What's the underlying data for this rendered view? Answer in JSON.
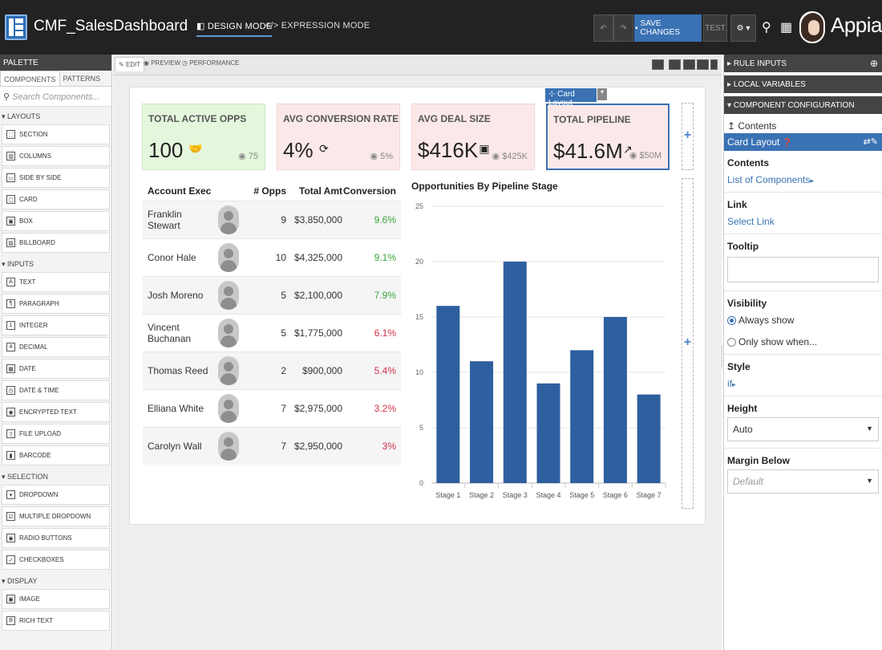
{
  "topbar": {
    "app_title": "CMF_SalesDashboard",
    "design_mode": "DESIGN MODE",
    "expression_mode": "EXPRESSION MODE",
    "save_changes": "SAVE CHANGES",
    "test": "TEST",
    "brand": "Appian",
    "icons": [
      "undo-icon",
      "redo-icon",
      "save-icon",
      "gear-icon",
      "search-people-icon",
      "apps-grid-icon"
    ]
  },
  "palette": {
    "header": "PALETTE",
    "tabs": [
      "COMPONENTS",
      "PATTERNS"
    ],
    "search_placeholder": "Search Components...",
    "sections": [
      {
        "title": "LAYOUTS",
        "items": [
          {
            "label": "SECTION",
            "icon": "section-icon",
            "glyph": "⬚"
          },
          {
            "label": "COLUMNS",
            "icon": "columns-icon",
            "glyph": "▥"
          },
          {
            "label": "SIDE BY SIDE",
            "icon": "side-by-side-icon",
            "glyph": "▭"
          },
          {
            "label": "CARD",
            "icon": "card-icon",
            "glyph": "▢"
          },
          {
            "label": "BOX",
            "icon": "box-icon",
            "glyph": "▣"
          },
          {
            "label": "BILLBOARD",
            "icon": "billboard-icon",
            "glyph": "▨"
          }
        ]
      },
      {
        "title": "INPUTS",
        "items": [
          {
            "label": "TEXT",
            "icon": "text-icon",
            "glyph": "A"
          },
          {
            "label": "PARAGRAPH",
            "icon": "paragraph-icon",
            "glyph": "¶"
          },
          {
            "label": "INTEGER",
            "icon": "integer-icon",
            "glyph": "1"
          },
          {
            "label": "DECIMAL",
            "icon": "decimal-icon",
            "glyph": "4"
          },
          {
            "label": "DATE",
            "icon": "date-icon",
            "glyph": "▦"
          },
          {
            "label": "DATE & TIME",
            "icon": "date-time-icon",
            "glyph": "◷"
          },
          {
            "label": "ENCRYPTED TEXT",
            "icon": "lock-icon",
            "glyph": "◉"
          },
          {
            "label": "FILE UPLOAD",
            "icon": "upload-icon",
            "glyph": "⇧"
          },
          {
            "label": "BARCODE",
            "icon": "barcode-icon",
            "glyph": "▮"
          }
        ]
      },
      {
        "title": "SELECTION",
        "items": [
          {
            "label": "DROPDOWN",
            "icon": "dropdown-icon",
            "glyph": "▾"
          },
          {
            "label": "MULTIPLE DROPDOWN",
            "icon": "multiple-dropdown-icon",
            "glyph": "☑"
          },
          {
            "label": "RADIO BUTTONS",
            "icon": "radio-icon",
            "glyph": "◉"
          },
          {
            "label": "CHECKBOXES",
            "icon": "checkbox-icon",
            "glyph": "✓"
          }
        ]
      },
      {
        "title": "DISPLAY",
        "items": [
          {
            "label": "IMAGE",
            "icon": "image-icon",
            "glyph": "▣"
          },
          {
            "label": "RICH TEXT",
            "icon": "rich-text-icon",
            "glyph": "B"
          }
        ]
      }
    ]
  },
  "editor": {
    "tabs": [
      "EDIT",
      "PREVIEW",
      "PERFORMANCE"
    ]
  },
  "kpis": [
    {
      "label": "TOTAL ACTIVE OPPS",
      "value": "100",
      "sub": "75",
      "icon": "handshake-icon",
      "glyph": "🤝",
      "bg": "#e4f7dc",
      "border": "#cfe9c4"
    },
    {
      "label": "AVG CONVERSION RATE",
      "value": "4%",
      "sub": "5%",
      "icon": "refresh-icon",
      "glyph": "⟳",
      "bg": "#fbe9e9",
      "border": "#f0d4d4"
    },
    {
      "label": "AVG DEAL SIZE",
      "value": "$416K",
      "sub": "$425K",
      "icon": "money-icon",
      "glyph": "▣",
      "bg": "#fbe9e9",
      "border": "#f0d4d4"
    },
    {
      "label": "TOTAL PIPELINE",
      "value": "$41.6M",
      "sub": "$50M",
      "icon": "trend-up-icon",
      "glyph": "↗",
      "bg": "#fbe9e9",
      "border": "#3a72b4"
    }
  ],
  "card_layout_tag": "Card Layout",
  "table": {
    "headers": [
      "Account Exec",
      "# Opps",
      "Total Amt",
      "Conversion"
    ],
    "rows": [
      {
        "name": "Franklin Stewart",
        "opps": "9",
        "amt": "$3,850,000",
        "conv": "9.6%",
        "good": true
      },
      {
        "name": "Conor Hale",
        "opps": "10",
        "amt": "$4,325,000",
        "conv": "9.1%",
        "good": true
      },
      {
        "name": "Josh Moreno",
        "opps": "5",
        "amt": "$2,100,000",
        "conv": "7.9%",
        "good": true
      },
      {
        "name": "Vincent Buchanan",
        "opps": "5",
        "amt": "$1,775,000",
        "conv": "6.1%",
        "good": false
      },
      {
        "name": "Thomas Reed",
        "opps": "2",
        "amt": "$900,000",
        "conv": "5.4%",
        "good": false
      },
      {
        "name": "Elliana White",
        "opps": "7",
        "amt": "$2,975,000",
        "conv": "3.2%",
        "good": false
      },
      {
        "name": "Carolyn Wall",
        "opps": "7",
        "amt": "$2,950,000",
        "conv": "3%",
        "good": false
      }
    ],
    "colors": {
      "good": "#3aa53a",
      "bad": "#d0304a"
    }
  },
  "chart_data": {
    "type": "bar",
    "title": "Opportunities By Pipeline Stage",
    "categories": [
      "Stage 1",
      "Stage 2",
      "Stage 3",
      "Stage 4",
      "Stage 5",
      "Stage 6",
      "Stage 7"
    ],
    "values": [
      16,
      11,
      20,
      9,
      12,
      15,
      8
    ],
    "ylim": [
      0,
      25
    ],
    "yticks": [
      0,
      5,
      10,
      15,
      20,
      25
    ],
    "color": "#2e5f9e",
    "grid": true
  },
  "rightpanel": {
    "rule_inputs": "RULE INPUTS",
    "local_variables": "LOCAL VARIABLES",
    "component_configuration": "COMPONENT CONFIGURATION",
    "contents_link": "Contents",
    "selected": "Card Layout",
    "contents_label": "Contents",
    "contents_value": "List of Components",
    "link_label": "Link",
    "link_value": "Select Link",
    "tooltip_label": "Tooltip",
    "visibility_label": "Visibility",
    "vis_always": "Always show",
    "vis_when": "Only show when...",
    "style_label": "Style",
    "style_value": "if",
    "height_label": "Height",
    "height_value": "Auto",
    "margin_label": "Margin Below",
    "margin_value": "Default"
  }
}
